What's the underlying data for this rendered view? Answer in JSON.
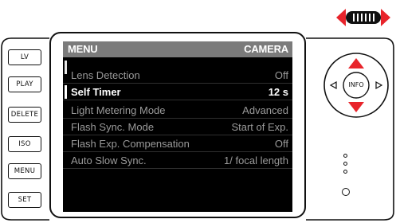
{
  "left_buttons": [
    "LV",
    "PLAY",
    "DELETE",
    "ISO",
    "MENU",
    "SET"
  ],
  "menu": {
    "title_left": "MENU",
    "title_right": "CAMERA",
    "items": [
      {
        "label": "Lens Detection",
        "value": "Off"
      },
      {
        "label": "Self Timer",
        "value": "12 s"
      },
      {
        "label": "Light Metering Mode",
        "value": "Advanced"
      },
      {
        "label": "Flash Sync. Mode",
        "value": "Start of Exp."
      },
      {
        "label": "Flash Exp. Compensation",
        "value": "Off"
      },
      {
        "label": "Auto Slow Sync.",
        "value": "1/ focal length"
      }
    ],
    "selected_index": 1
  },
  "pad": {
    "center_label": "INFO"
  },
  "colors": {
    "accent": "#e8242b",
    "screen_bg": "#000000",
    "header_bg": "#7b7b7b"
  },
  "icons": [
    "thumbwheel-icon",
    "arrow-up-icon",
    "arrow-down-icon",
    "arrow-left-icon",
    "arrow-right-icon"
  ]
}
